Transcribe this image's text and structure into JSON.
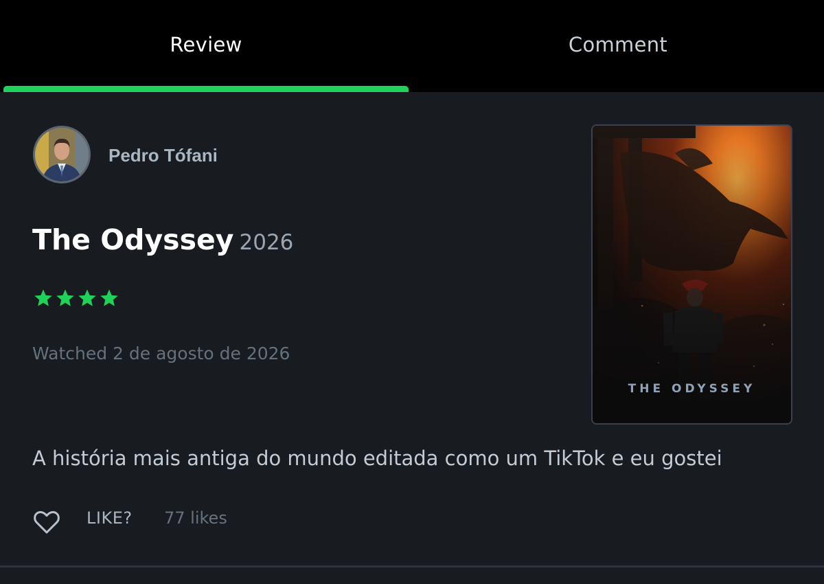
{
  "tabs": [
    {
      "label": "Review",
      "active": true
    },
    {
      "label": "Comment",
      "active": false
    }
  ],
  "colors": {
    "accent": "#1fd25a",
    "background": "#181b20",
    "tabbar": "#000000"
  },
  "review": {
    "author": "Pedro Tófani",
    "film_title": "The Odyssey",
    "film_year": "2026",
    "rating_stars": 4,
    "watched": "Watched 2 de agosto de 2026",
    "text": "A história mais antiga do mundo editada como um TikTok e eu gostei",
    "like_label": "LIKE?",
    "likes_count": "77 likes"
  },
  "poster": {
    "title_text": "THE ODYSSEY"
  },
  "icons": {
    "star": "star-icon",
    "like": "heart-outline-icon"
  }
}
